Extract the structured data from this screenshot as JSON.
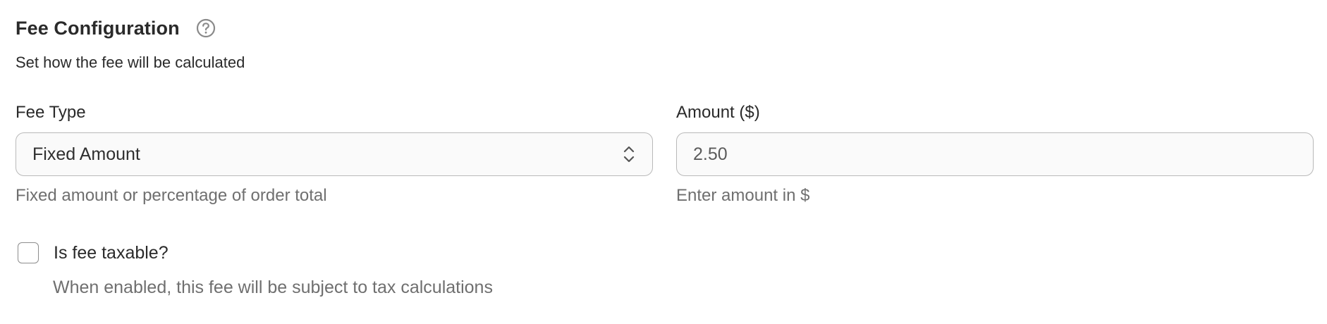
{
  "section": {
    "title": "Fee Configuration",
    "help_icon": "help-circle-icon",
    "subtitle": "Set how the fee will be calculated"
  },
  "fee_type": {
    "label": "Fee Type",
    "selected": "Fixed Amount",
    "hint": "Fixed amount or percentage of order total",
    "icon": "chevron-up-down-icon"
  },
  "amount": {
    "label": "Amount ($)",
    "value": "2.50",
    "hint": "Enter amount in $"
  },
  "taxable": {
    "label": "Is fee taxable?",
    "checked": false,
    "hint": "When enabled, this fee will be subject to tax calculations"
  },
  "colors": {
    "text": "#2a2a2a",
    "muted": "#6f6f6f",
    "border": "#b9b9b9",
    "field_bg": "#fafafa"
  }
}
